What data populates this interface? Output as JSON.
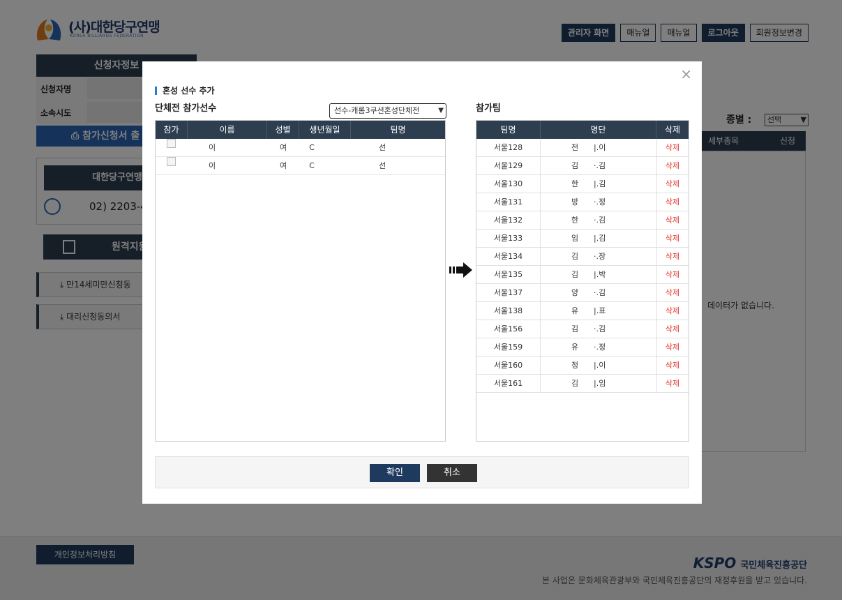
{
  "header": {
    "logo_text": "(사)대한당구연맹",
    "logo_sub": "KOREA BILLIARDS FEDERATION",
    "buttons": [
      "관리자 화면",
      "매뉴얼",
      "매뉴얼",
      "로그아웃",
      "회원정보변경"
    ]
  },
  "sidebar": {
    "applicant_title": "신청자정보",
    "name_label": "신청자명",
    "region_label": "소속시도",
    "print_label": "참가신청서 출",
    "org_name": "대한당구연맹",
    "phone": "02) 2203-4",
    "remote_label": "원격지원",
    "download1": "만14세미만신청동",
    "download2": "대리신청동의서"
  },
  "right_panel": {
    "category_label": "종별 :",
    "category_value": "선택",
    "col_event": "세부종목",
    "col_apply": "신청",
    "no_data": "데이터가 없습니다."
  },
  "footer": {
    "privacy": "개인정보처리방침",
    "kspo": "KSPO",
    "kspo_name": "국민체육진흥공단",
    "note": "본 사업은 문화체육관광부와 국민체육진흥공단의 재정후원을 받고 있습니다."
  },
  "modal": {
    "close": "×",
    "title": "혼성 선수 추가",
    "left_title": "단체전 참가선수",
    "right_title": "참가팀",
    "type_select": "선수-캐롬3쿠션혼성단체전",
    "left_headers": [
      "참가",
      "이름",
      "성별",
      "생년월일",
      "팀명"
    ],
    "left_rows": [
      {
        "name": "이",
        "gender": "여",
        "birth": "C",
        "team": "선"
      },
      {
        "name": "이",
        "gender": "여",
        "birth": "C",
        "team": "선"
      }
    ],
    "right_headers": [
      "팀명",
      "명단",
      "삭제"
    ],
    "right_rows": [
      {
        "team": "서울128",
        "m1": "전",
        "m2": "|.이",
        "del": "삭제"
      },
      {
        "team": "서울129",
        "m1": "김",
        "m2": "·.김",
        "del": "삭제"
      },
      {
        "team": "서울130",
        "m1": "한",
        "m2": "|.김",
        "del": "삭제"
      },
      {
        "team": "서울131",
        "m1": "방",
        "m2": "·.정",
        "del": "삭제"
      },
      {
        "team": "서울132",
        "m1": "한",
        "m2": "·.김",
        "del": "삭제"
      },
      {
        "team": "서울133",
        "m1": "임",
        "m2": "|.김",
        "del": "삭제"
      },
      {
        "team": "서울134",
        "m1": "김",
        "m2": "·.장",
        "del": "삭제"
      },
      {
        "team": "서울135",
        "m1": "김",
        "m2": "|.박",
        "del": "삭제"
      },
      {
        "team": "서울137",
        "m1": "양",
        "m2": "·.김",
        "del": "삭제"
      },
      {
        "team": "서울138",
        "m1": "유",
        "m2": "|.표",
        "del": "삭제"
      },
      {
        "team": "서울156",
        "m1": "김",
        "m2": "·.김",
        "del": "삭제"
      },
      {
        "team": "서울159",
        "m1": "유",
        "m2": "·.정",
        "del": "삭제"
      },
      {
        "team": "서울160",
        "m1": "정",
        "m2": "|.이",
        "del": "삭제"
      },
      {
        "team": "서울161",
        "m1": "김",
        "m2": "|.임",
        "del": "삭제"
      }
    ],
    "ok": "확인",
    "cancel": "취소"
  },
  "colors": {
    "navy": "#2d3e50",
    "accent_blue": "#2b65b7",
    "delete_red": "#e0322b"
  }
}
